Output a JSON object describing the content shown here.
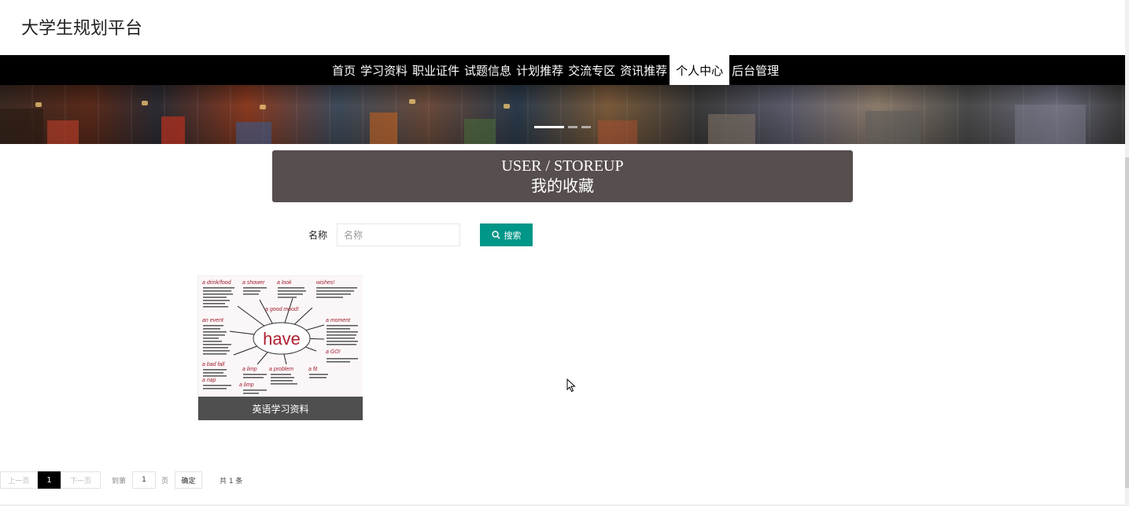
{
  "header": {
    "site_title": "大学生规划平台"
  },
  "nav": {
    "items": [
      "首页",
      "学习资料",
      "职业证件",
      "试题信息",
      "计划推荐",
      "交流专区",
      "资讯推荐",
      "个人中心",
      "后台管理"
    ],
    "active_index": 7
  },
  "banner": {
    "slide_count": 3,
    "active_slide": 1
  },
  "section": {
    "title_en": "USER / STOREUP",
    "title_cn": "我的收藏"
  },
  "search": {
    "label": "名称",
    "placeholder": "名称",
    "value": "",
    "button_label": "搜索",
    "button_color": "#009688"
  },
  "favorites": [
    {
      "title": "英语学习资料",
      "image": {
        "center_word": "have",
        "headings": [
          "a drink/food",
          "a shower",
          "a look",
          "wishes!",
          "a good mood!",
          "an event",
          "a moment",
          "a bad fall",
          "a limp",
          "a problem",
          "a fit",
          "a GO!",
          "a nap",
          "a limp"
        ]
      }
    }
  ],
  "pagination": {
    "prev_label": "上一页",
    "current_page": "1",
    "next_label": "下一页",
    "goto_label": "到第",
    "goto_value": "1",
    "page_unit": "页",
    "confirm_label": "确定",
    "total_text": "共 1 条"
  },
  "colors": {
    "nav_bg": "#000000",
    "section_bg": "#574e4e",
    "caption_bg": "#4f4f4f",
    "accent": "#009688"
  }
}
